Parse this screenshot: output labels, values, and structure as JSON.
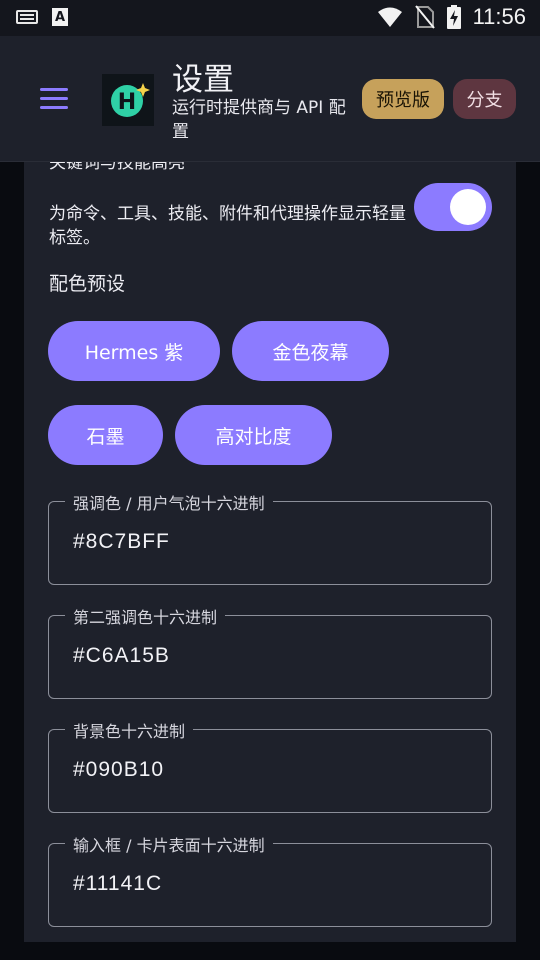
{
  "status_bar": {
    "time": "11:56",
    "left_icons": [
      "keyboard-icon",
      "accessibility-a-icon"
    ],
    "right_icons": [
      "wifi-icon",
      "no-sim-icon",
      "battery-charging-icon"
    ]
  },
  "app_bar": {
    "title": "设置",
    "subtitle": "运行时提供商与 API 配置",
    "preview_chip": "预览版",
    "branch_chip": "分支",
    "logo_letter": "H"
  },
  "highlight": {
    "title_cut": "关键词与技能高亮",
    "description": "为命令、工具、技能、附件和代理操作显示轻量标签。",
    "toggle_on": true
  },
  "presets": {
    "label": "配色预设",
    "items": [
      "Hermes 紫",
      "金色夜幕",
      "石墨",
      "高对比度"
    ]
  },
  "fields": [
    {
      "label": "强调色 / 用户气泡十六进制",
      "value": "#8C7BFF"
    },
    {
      "label": "第二强调色十六进制",
      "value": "#C6A15B"
    },
    {
      "label": "背景色十六进制",
      "value": "#090B10"
    },
    {
      "label": "输入框 / 卡片表面十六进制",
      "value": "#11141C"
    }
  ],
  "colors": {
    "accent": "#8C7BFF",
    "secondary": "#C6A15B",
    "background": "#090B10",
    "surface": "#11141C"
  }
}
